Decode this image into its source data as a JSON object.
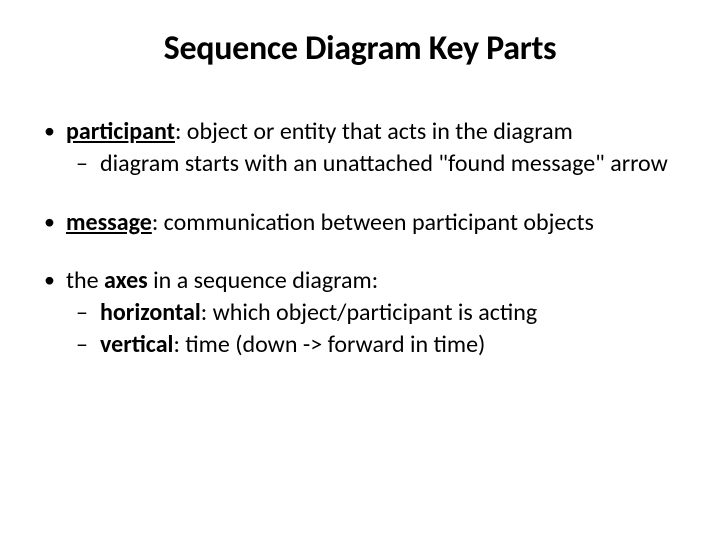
{
  "title": "Sequence Diagram Key Parts",
  "items": [
    {
      "term": "participant",
      "desc": ": object or entity that acts in the diagram",
      "subs": [
        {
          "text": "diagram starts with an unattached \"found message\" arrow"
        }
      ]
    },
    {
      "term": "message",
      "desc": ": communication between participant objects",
      "subs": []
    },
    {
      "prefix": "the ",
      "term": "axes",
      "desc": " in a sequence diagram:",
      "subs": [
        {
          "label": "horizontal",
          "text": ": which object/participant is acting"
        },
        {
          "label": "vertical",
          "text": ": time  (down -> forward in time)"
        }
      ]
    }
  ]
}
